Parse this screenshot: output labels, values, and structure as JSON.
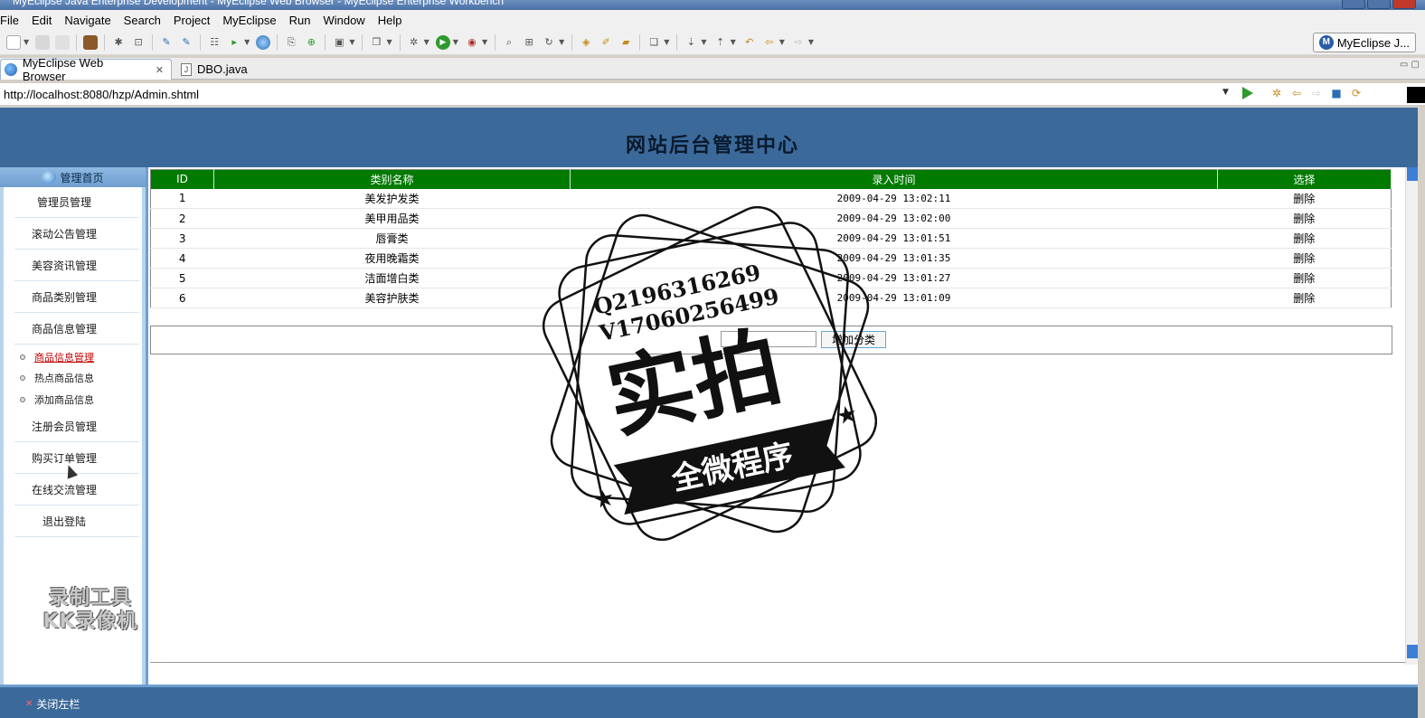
{
  "window": {
    "title": "MyEclipse Java Enterprise Development - MyEclipse Web Browser - MyEclipse Enterprise Workbench"
  },
  "menu": [
    "File",
    "Edit",
    "Navigate",
    "Search",
    "Project",
    "MyEclipse",
    "Run",
    "Window",
    "Help"
  ],
  "perspective": {
    "label": "MyEclipse J..."
  },
  "tabs": {
    "browser": "MyEclipse Web Browser",
    "dbo": "DBO.java"
  },
  "address": {
    "url": "http://localhost:8080/hzp/Admin.shtml"
  },
  "page": {
    "title": "网站后台管理中心",
    "sidebar_head": "管理首页",
    "sidebar": [
      "管理员管理",
      "滚动公告管理",
      "美容资讯管理",
      "商品类别管理",
      "商品信息管理"
    ],
    "sidebar_sub": [
      "商品信息管理",
      "热点商品信息",
      "添加商品信息"
    ],
    "sidebar_rest": [
      "注册会员管理",
      "购买订单管理",
      "在线交流管理",
      "退出登陆"
    ],
    "table": {
      "headers": [
        "ID",
        "类别名称",
        "录入时间",
        "选择"
      ],
      "rows": [
        [
          "1",
          "美发护发类",
          "2009-04-29 13:02:11",
          "删除"
        ],
        [
          "2",
          "美甲用品类",
          "2009-04-29 13:02:00",
          "删除"
        ],
        [
          "3",
          "唇膏类",
          "2009-04-29 13:01:51",
          "删除"
        ],
        [
          "4",
          "夜用晚霜类",
          "2009-04-29 13:01:35",
          "删除"
        ],
        [
          "5",
          "洁面增白类",
          "2009-04-29 13:01:27",
          "删除"
        ],
        [
          "6",
          "美容护肤类",
          "2009-04-29 13:01:09",
          "删除"
        ]
      ]
    },
    "add_button": "增加分类",
    "close_left": "关闭左栏"
  },
  "watermarks": {
    "stamp_line1": "Q2196316269",
    "stamp_line2": "V17060256499",
    "stamp_big": "实拍",
    "stamp_banner": "全微程序",
    "kk_line1": "录制工具",
    "kk_line2": "KK录像机"
  },
  "colors": {
    "header_blue": "#3b6a9a",
    "table_header_green": "#007a00",
    "sidebar_blue": "#b8d3ec"
  }
}
